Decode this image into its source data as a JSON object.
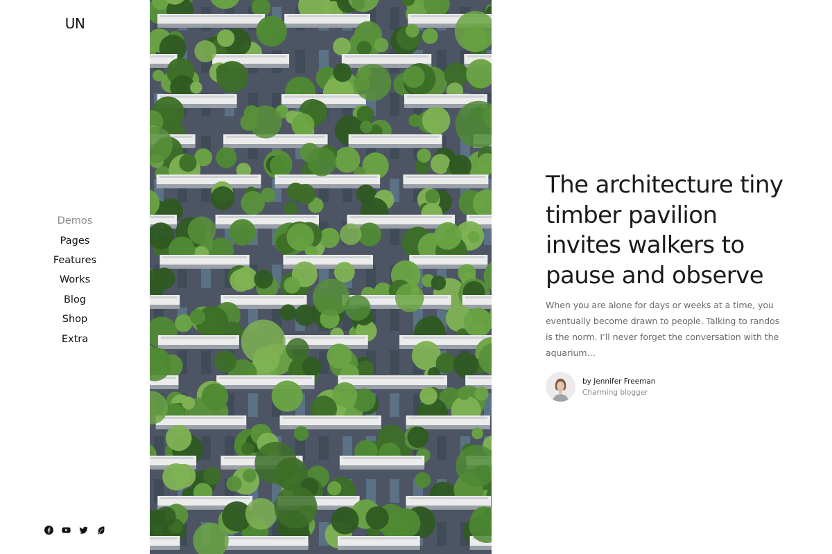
{
  "brand": {
    "logo": "UN"
  },
  "nav": {
    "items": [
      {
        "label": "Demos"
      },
      {
        "label": "Pages"
      },
      {
        "label": "Features"
      },
      {
        "label": "Works"
      },
      {
        "label": "Blog"
      },
      {
        "label": "Shop"
      },
      {
        "label": "Extra"
      }
    ]
  },
  "social": [
    "facebook-icon",
    "youtube-icon",
    "twitter-icon",
    "leaf-icon"
  ],
  "post": {
    "title": "The architecture tiny timber pavilion invites walkers to pause and observe",
    "excerpt": "When you are alone for days or weeks at a time, you eventually become drawn to people. Talking to randos is the norm. I’ll never forget the conversation with the aquarium…",
    "author_name": "by Jennifer Freeman",
    "author_role": "Charming blogger"
  },
  "colors": {
    "text": "#1b1b1b",
    "muted": "#8a8a8a",
    "facade": "#4e5766",
    "foliage": "#4f8a34"
  }
}
